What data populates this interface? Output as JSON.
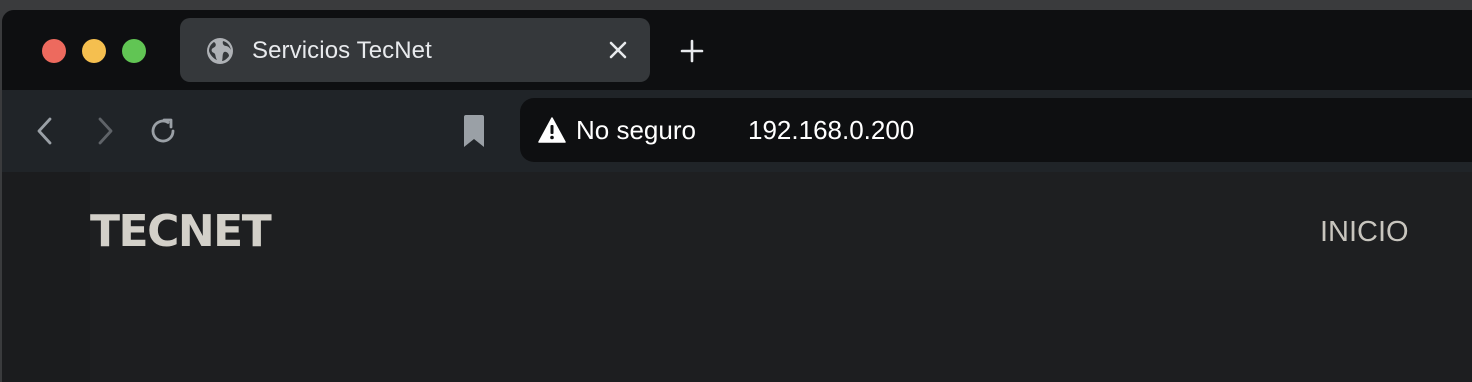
{
  "browser": {
    "tab": {
      "title": "Servicios TecNet",
      "favicon": "globe-icon"
    },
    "omnibox": {
      "security_label": "No seguro",
      "security_icon": "warning-icon",
      "url": "192.168.0.200"
    },
    "colors": {
      "traffic_red": "#ed6a5e",
      "traffic_yellow": "#f5bf4f",
      "traffic_green": "#61c554"
    }
  },
  "site": {
    "logo": "TECNET",
    "nav": {
      "items": [
        {
          "label": "INICIO"
        }
      ]
    }
  }
}
